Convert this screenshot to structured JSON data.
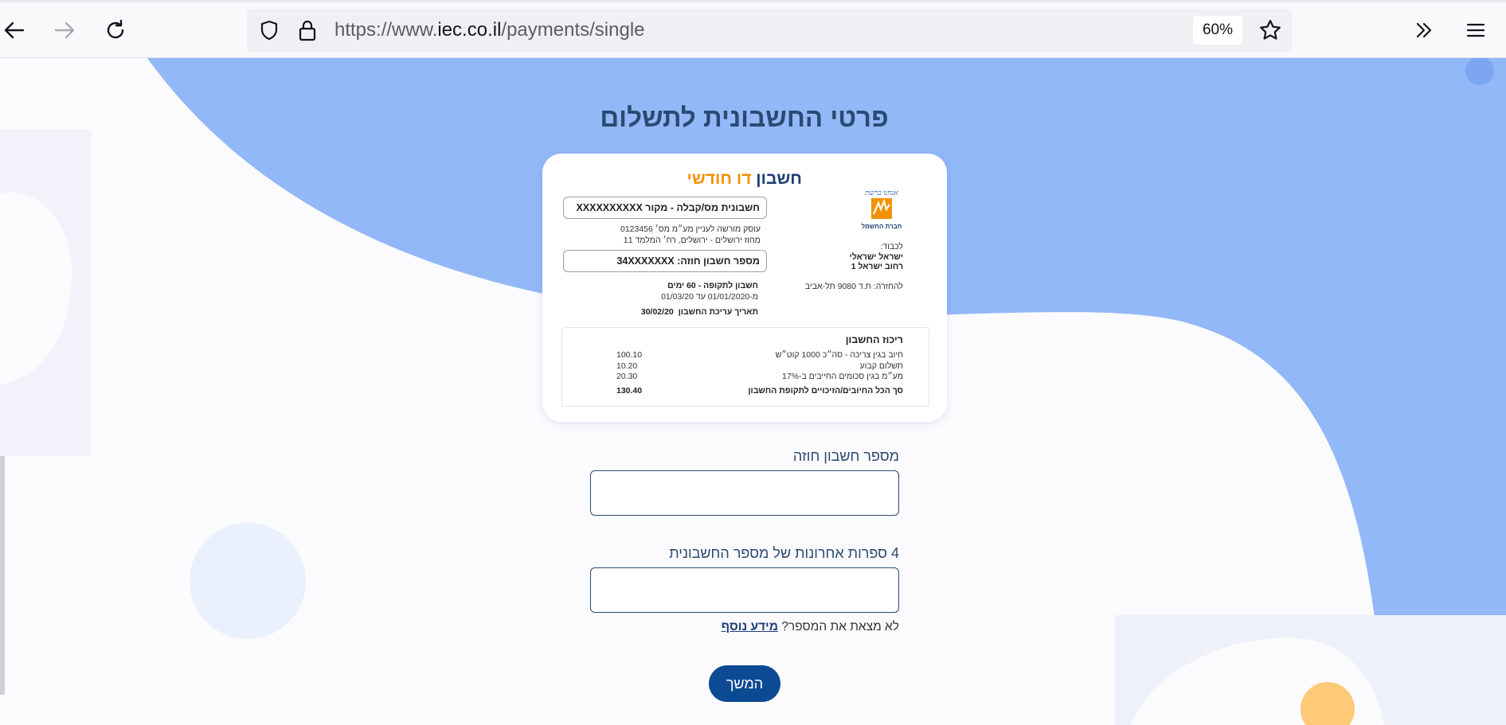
{
  "browser": {
    "url_prefix": "https://www.",
    "url_host": "iec.co.il",
    "url_path": "/payments/single",
    "zoom": "60%"
  },
  "page": {
    "title": "פרטי החשבונית לתשלום"
  },
  "bill": {
    "title_main": "חשבון",
    "title_accent": "דו חודשי",
    "logo_script": "אנחנו ברשת",
    "logo_caption": "חברת החשמל",
    "invoice_field": "חשבונית מס/קבלה - מקור XXXXXXXXXX",
    "business_line1": "עוסק מורשה לעניין מע״מ מס׳ 0123456",
    "business_line2": "מחוז ירושלים - ירושלים, רח׳ המלמד 11",
    "contract_field": "מספר חשבון חוזה: 34XXXXXXX",
    "period_line": "חשבון לתקופה - 60 ימים",
    "dates_line": "מ-01/01/2020 עד 01/03/20",
    "issue_label": "תאריך עריכת החשבון",
    "issue_date": "30/02/20",
    "to_label": "לכבוד:",
    "to_name": "ישראל ישראלי",
    "to_street": "רחוב ישראל 1",
    "return_address": "להחזרה: ת.ד 9080 תל-אביב",
    "summary": {
      "heading": "ריכוז החשבון",
      "rows": [
        {
          "label": "חיוב בגין צריכה - סה״כ 1000 קוט״ש",
          "value": "100.10"
        },
        {
          "label": "תשלום קבוע",
          "value": "10.20"
        },
        {
          "label": "מע״מ בגין סכומים החייבים ב-17%",
          "value": "20.30"
        }
      ],
      "total_label": "סך הכל החיובים/הזיכויים לתקופת החשבון",
      "total_value": "130.40"
    }
  },
  "form": {
    "contract_label": "מספר חשבון חוזה",
    "contract_value": "",
    "digits_label": "4 ספרות אחרונות של מספר החשבונית",
    "digits_value": "",
    "help_text": "לא מצאת את המספר?",
    "help_link": "מידע נוסף",
    "continue_label": "המשך"
  }
}
